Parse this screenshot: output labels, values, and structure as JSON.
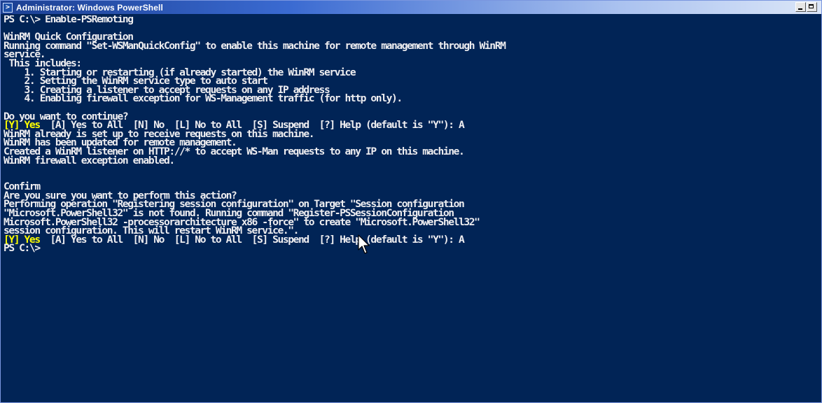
{
  "window": {
    "title": "Administrator: Windows PowerShell",
    "app_icon_glyph": ">",
    "icon": "powershell-icon",
    "background_color": "#012456",
    "text_color": "#eeedf0",
    "highlight_color": "#ffff00"
  },
  "console": {
    "lines": [
      {
        "text": "PS C:\\> Enable-PSRemoting"
      },
      {
        "text": ""
      },
      {
        "text": "WinRM Quick Configuration"
      },
      {
        "text": "Running command \"Set-WSManQuickConfig\" to enable this machine for remote management through WinRM"
      },
      {
        "text": "service."
      },
      {
        "text": " This includes:"
      },
      {
        "text": "    1. Starting or restarting (if already started) the WinRM service"
      },
      {
        "text": "    2. Setting the WinRM service type to auto start"
      },
      {
        "text": "    3. Creating a listener to accept requests on any IP address"
      },
      {
        "text": "    4. Enabling firewall exception for WS-Management traffic (for http only)."
      },
      {
        "text": ""
      },
      {
        "text": "Do you want to continue?"
      },
      {
        "yes": "[Y] Yes",
        "rest": "  [A] Yes to All  [N] No  [L] No to All  [S] Suspend  [?] Help (default is \"Y\"): A"
      },
      {
        "text": "WinRM already is set up to receive requests on this machine."
      },
      {
        "text": "WinRM has been updated for remote management."
      },
      {
        "text": "Created a WinRM listener on HTTP://* to accept WS-Man requests to any IP on this machine."
      },
      {
        "text": "WinRM firewall exception enabled."
      },
      {
        "text": ""
      },
      {
        "text": ""
      },
      {
        "text": "Confirm"
      },
      {
        "text": "Are you sure you want to perform this action?"
      },
      {
        "text": "Performing operation \"Registering session configuration\" on Target \"Session configuration"
      },
      {
        "text": "\"Microsoft.PowerShell32\" is not found. Running command \"Register-PSSessionConfiguration"
      },
      {
        "text": "Microsoft.PowerShell32 -processorarchitecture x86 -force\" to create \"Microsoft.PowerShell32\""
      },
      {
        "text": "session configuration. This will restart WinRM service.\"."
      },
      {
        "yes": "[Y] Yes",
        "rest": "  [A] Yes to All  [N] No  [L] No to All  [S] Suspend  [?] Help (default is \"Y\"): A"
      },
      {
        "text": "PS C:\\>"
      }
    ]
  }
}
